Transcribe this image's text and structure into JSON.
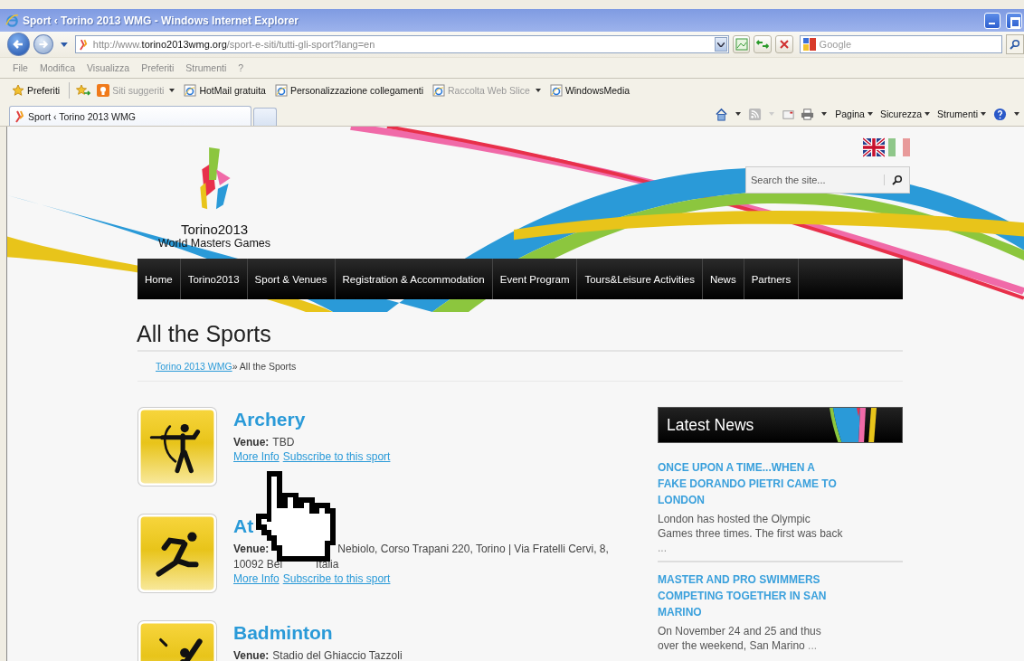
{
  "window": {
    "title": "Sport ‹ Torino 2013 WMG - Windows Internet Explorer"
  },
  "address_bar": {
    "url_prefix": "http://www.",
    "url_host": "torino2013wmg.org",
    "url_path": "/sport-e-siti/tutti-gli-sport?lang=en"
  },
  "search_box": {
    "placeholder": "Google"
  },
  "menu": [
    "File",
    "Modifica",
    "Visualizza",
    "Preferiti",
    "Strumenti",
    "?"
  ],
  "favorites_bar": [
    {
      "label": "Preferiti",
      "kind": "favorites",
      "disabled": false
    },
    {
      "label": "Siti suggeriti",
      "kind": "suggested",
      "disabled": true
    },
    {
      "label": "HotMail gratuita",
      "kind": "link",
      "disabled": false
    },
    {
      "label": "Personalizzazione collegamenti",
      "kind": "link",
      "disabled": false
    },
    {
      "label": "Raccolta Web Slice",
      "kind": "slice",
      "disabled": true
    },
    {
      "label": "WindowsMedia",
      "kind": "link",
      "disabled": false
    }
  ],
  "tab": {
    "title": "Sport ‹ Torino 2013 WMG"
  },
  "command_bar": [
    "Pagina",
    "Sicurezza",
    "Strumenti"
  ],
  "site": {
    "logo": [
      "Torino2013",
      "World Masters Games"
    ],
    "search": {
      "placeholder": "Search the site..."
    },
    "nav": [
      "Home",
      "Torino2013",
      "Sport & Venues",
      "Registration & Accommodation",
      "Event Program",
      "Tours&Leisure Activities",
      "News",
      "Partners"
    ],
    "page_title": "All the Sports",
    "breadcrumb": {
      "link": "Torino 2013 WMG",
      "separator": "»",
      "current": "All the Sports"
    },
    "sports": [
      {
        "name": "Archery",
        "kind": "archery",
        "venue_label": "Venue:",
        "venue_lines": [
          [
            "TBD"
          ]
        ],
        "links": [
          "More Info",
          "Subscribe to this sport"
        ]
      },
      {
        "name": "At",
        "kind": "running",
        "covered": true,
        "venue_label": "Venue:",
        "venue_lines": [
          [
            "Nebiolo, Corso Trapani 220, Torino | Via Fratelli Cervi, 8,"
          ],
          [
            "10092 Bei",
            "Italia"
          ]
        ],
        "links": [
          "More Info",
          "Subscribe to this sport"
        ]
      },
      {
        "name": "Badminton",
        "kind": "badminton",
        "venue_label": "Venue:",
        "venue_lines": [
          [
            "Stadio del Ghiaccio Tazzoli"
          ]
        ]
      }
    ],
    "news": {
      "heading": "Latest News",
      "items": [
        {
          "title": "ONCE UPON A TIME...WHEN A FAKE DORANDO PIETRI CAME TO LONDON",
          "excerpt": "London has hosted the Olympic Games three times. The first was back",
          "more": "..."
        },
        {
          "title": "MASTER AND PRO SWIMMERS COMPETING TOGETHER IN SAN MARINO",
          "excerpt": "On November 24 and 25 and thus over the weekend, San Marino",
          "more": "..."
        }
      ]
    }
  }
}
